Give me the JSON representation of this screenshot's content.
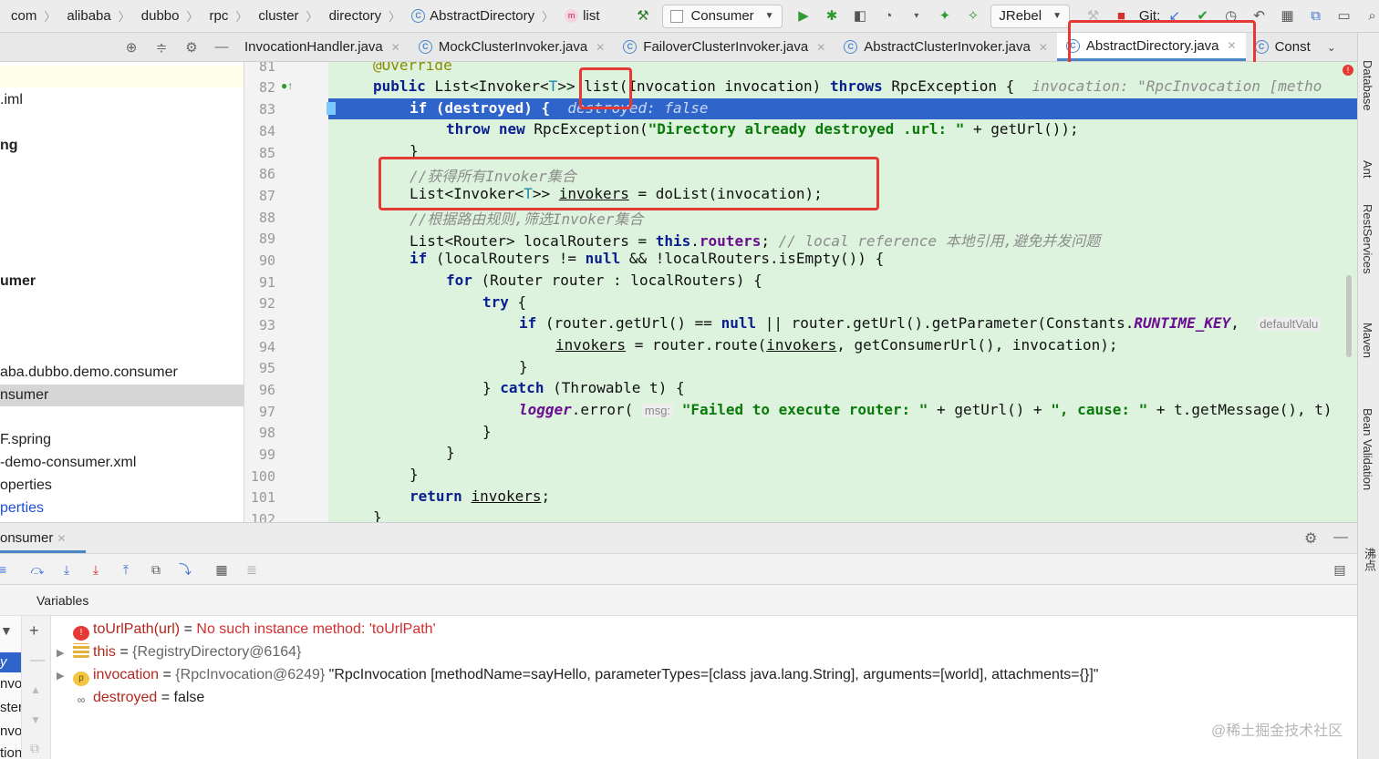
{
  "breadcrumbs": [
    "com",
    "alibaba",
    "dubbo",
    "rpc",
    "cluster",
    "directory",
    "AbstractDirectory",
    "list"
  ],
  "toolbar": {
    "run_config": "Consumer",
    "jrebel": "JRebel",
    "git_label": "Git:"
  },
  "tabs": [
    {
      "label": "InvocationHandler.java",
      "active": false
    },
    {
      "label": "MockClusterInvoker.java",
      "active": false
    },
    {
      "label": "FailoverClusterInvoker.java",
      "active": false
    },
    {
      "label": "AbstractClusterInvoker.java",
      "active": false
    },
    {
      "label": "AbstractDirectory.java",
      "active": true
    },
    {
      "label": "Const",
      "active": false
    }
  ],
  "project_tree": [
    {
      "text": ".iml"
    },
    {
      "text": "ng"
    },
    {
      "text": "umer"
    },
    {
      "text": "aba.dubbo.demo.consumer"
    },
    {
      "text": "nsumer"
    },
    {
      "text": "F.spring"
    },
    {
      "text": "-demo-consumer.xml"
    },
    {
      "text": "operties"
    },
    {
      "text": "perties"
    }
  ],
  "editor": {
    "line_numbers": [
      "81",
      "82",
      "83",
      "84",
      "85",
      "86",
      "87",
      "88",
      "89",
      "90",
      "91",
      "92",
      "93",
      "94",
      "95",
      "96",
      "97",
      "98",
      "99",
      "100",
      "101",
      "102"
    ],
    "annotation": "@Override",
    "sig_public": "public",
    "sig_type": "List<Invoker<",
    "sig_T": "T",
    "sig_close": ">>",
    "sig_method": "list",
    "sig_params": "(Invocation invocation)",
    "sig_throws": "throws",
    "sig_exception": "RpcException {",
    "sig_hint": "invocation: \"RpcInvocation [metho",
    "l83_if": "if",
    "l83_cond": "(destroyed) {",
    "l83_hint": "destroyed: false",
    "l84_throw": "throw",
    "l84_new": "new",
    "l84_call": "RpcException(",
    "l84_str": "\"Directory already destroyed .url: \"",
    "l84_rest": "+ getUrl());",
    "l85": "}",
    "l86_comment": "//获得所有Invoker集合",
    "l87_type": "List<Invoker<",
    "l87_T": "T",
    "l87_close": ">>",
    "l87_var": "invokers",
    "l87_rest": "= doList(invocation);",
    "l88_comment": "//根据路由规则,筛选Invoker集合",
    "l89_type": "List<Router> localRouters =",
    "l89_this": "this",
    "l89_field": "routers",
    "l89_semi": ";",
    "l89_comment": "// local reference 本地引用,避免并发问题",
    "l90_if": "if",
    "l90_a": "(localRouters !=",
    "l90_null": "null",
    "l90_b": "&& !localRouters.isEmpty()) {",
    "l91_for": "for",
    "l91_rest": "(Router router : localRouters) {",
    "l92_try": "try",
    "l92_rest": "{",
    "l93_if": "if",
    "l93_a": "(router.getUrl() ==",
    "l93_null": "null",
    "l93_b": "|| router.getUrl().getParameter(Constants.",
    "l93_const": "RUNTIME_KEY",
    "l93_c": ",",
    "l93_hint": "defaultValu",
    "l94_var": "invokers",
    "l94_a": "= router.route(",
    "l94_var2": "invokers",
    "l94_b": ", getConsumerUrl(), invocation);",
    "l95": "}",
    "l96_a": "}",
    "l96_catch": "catch",
    "l96_b": "(Throwable t) {",
    "l97_logger": "logger",
    "l97_a": ".error(",
    "l97_hint": "msg:",
    "l97_str1": "\"Failed to execute router: \"",
    "l97_b": "+ getUrl() +",
    "l97_str2": "\", cause: \"",
    "l97_c": "+ t.getMessage(), t)",
    "l98": "}",
    "l99": "}",
    "l100": "}",
    "l101_return": "return",
    "l101_var": "invokers",
    "l101_semi": ";",
    "l102": "}"
  },
  "right_tools": [
    "Database",
    "Ant",
    "RestServices",
    "Maven",
    "Bean Validation",
    "沸点"
  ],
  "debug": {
    "session_tab": "onsumer",
    "variables_title": "Variables",
    "frames_partial": [
      "y (c",
      "nvo",
      "ster",
      "nvol",
      "tion"
    ],
    "variables": [
      {
        "name": "toUrlPath(url)",
        "eq": "=",
        "value": "No such instance method: 'toUrlPath'",
        "kind": "error"
      },
      {
        "name": "this",
        "eq": "=",
        "value": "{RegistryDirectory@6164}",
        "kind": "object"
      },
      {
        "name": "invocation",
        "eq": "=",
        "ref": "{RpcInvocation@6249}",
        "value": "\"RpcInvocation [methodName=sayHello, parameterTypes=[class java.lang.String], arguments=[world], attachments={}]\"",
        "kind": "param"
      },
      {
        "name": "destroyed",
        "eq": "=",
        "value": "false",
        "kind": "field"
      }
    ]
  },
  "watermark": "@稀土掘金技术社区",
  "colors": {
    "accent": "#4a86c8",
    "highlight": "#2f65ca",
    "code_bg": "#ddf3dd",
    "annotation_box": "#e53935"
  }
}
